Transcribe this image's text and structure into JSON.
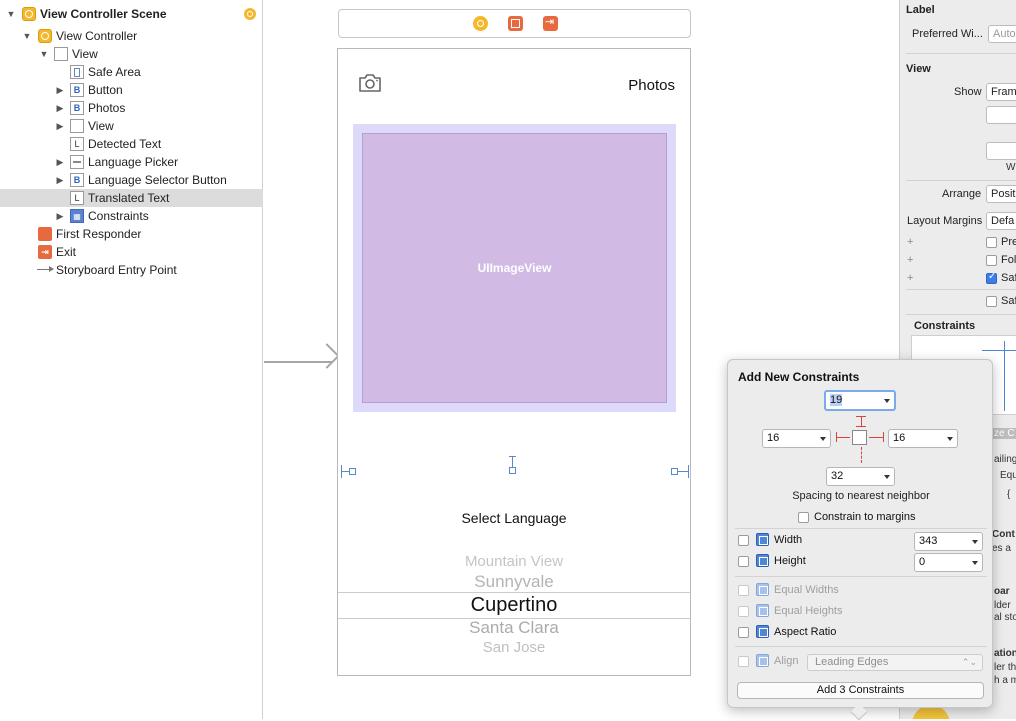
{
  "outline": {
    "items": [
      {
        "label": "View Controller Scene"
      },
      {
        "label": "View Controller"
      },
      {
        "label": "View"
      },
      {
        "label": "Safe Area"
      },
      {
        "label": "Button"
      },
      {
        "label": "Photos"
      },
      {
        "label": "View"
      },
      {
        "label": "Detected Text"
      },
      {
        "label": "Language Picker"
      },
      {
        "label": "Language Selector Button"
      },
      {
        "label": "Translated Text"
      },
      {
        "label": "Constraints"
      },
      {
        "label": "First Responder"
      },
      {
        "label": "Exit"
      },
      {
        "label": "Storyboard Entry Point"
      }
    ],
    "button_icon_glyph": "B",
    "label_icon_glyph": "L"
  },
  "canvas": {
    "photos_button": "Photos",
    "image_view_label": "UIImageView",
    "select_language": "Select Language",
    "picker_items": [
      "Mountain View",
      "Sunnyvale",
      "Cupertino",
      "Santa Clara",
      "San Jose"
    ]
  },
  "inspector": {
    "label_section": "Label",
    "preferred_width_label": "Preferred Wi...",
    "preferred_width_value": "Auto",
    "view_section": "View",
    "show_label": "Show",
    "show_value": "Fram",
    "wi_label": "Wi",
    "arrange_label": "Arrange",
    "arrange_value": "Posit",
    "layout_margins_label": "Layout Margins",
    "layout_margins_value": "Defa",
    "checks": [
      {
        "label": "Pre",
        "checked": false
      },
      {
        "label": "Fol",
        "checked": false
      },
      {
        "label": "Saf",
        "checked": true
      },
      {
        "label": "Saf",
        "checked": false
      }
    ],
    "constraints_section": "Constraints",
    "clipped_texts": [
      "ze C",
      "ailing",
      "Equ",
      "{",
      "Cont",
      "es a",
      "oar",
      "lder",
      "al sto",
      "ation",
      "ler th",
      "h a m"
    ]
  },
  "popover": {
    "title": "Add New Constraints",
    "top_value": "19",
    "left_value": "16",
    "right_value": "16",
    "bottom_value": "32",
    "spacing_label": "Spacing to nearest neighbor",
    "constrain_to_margins": "Constrain to margins",
    "width_label": "Width",
    "width_value": "343",
    "height_label": "Height",
    "height_value": "0",
    "equal_widths": "Equal Widths",
    "equal_heights": "Equal Heights",
    "aspect_ratio": "Aspect Ratio",
    "align_label": "Align",
    "align_value": "Leading Edges",
    "add_button": "Add 3 Constraints"
  },
  "colors": {
    "image_view_fill": "#d1bbe4",
    "image_container_fill": "#dcdaf8",
    "constraint_red": "#d9433e",
    "handle_blue": "#5a88c8",
    "selection_gray": "#dcdcdc"
  }
}
